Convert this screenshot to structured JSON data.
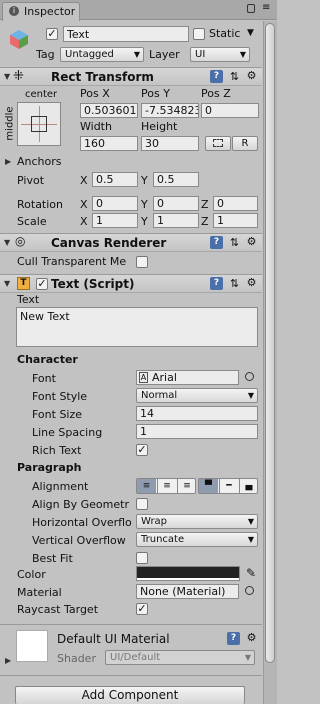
{
  "tab": {
    "label": "Inspector",
    "icon": "info-icon"
  },
  "header": {
    "object_name": "Text",
    "static_label": "Static",
    "tag_label": "Tag",
    "tag_value": "Untagged",
    "layer_label": "Layer",
    "layer_value": "UI"
  },
  "rect_transform": {
    "title": "Rect Transform",
    "anchor_h": "center",
    "anchor_v": "middle",
    "pos_x_label": "Pos X",
    "pos_y_label": "Pos Y",
    "pos_z_label": "Pos Z",
    "pos_x": "0.503601",
    "pos_y": "-7.534823",
    "pos_z": "0",
    "width_label": "Width",
    "height_label": "Height",
    "width": "160",
    "height": "30",
    "r_button": "R",
    "anchors_label": "Anchors",
    "pivot_label": "Pivot",
    "pivot_x": "0.5",
    "pivot_y": "0.5",
    "rotation_label": "Rotation",
    "rot_x": "0",
    "rot_y": "0",
    "rot_z": "0",
    "scale_label": "Scale",
    "scale_x": "1",
    "scale_y": "1",
    "scale_z": "1",
    "x": "X",
    "y": "Y",
    "z": "Z"
  },
  "canvas_renderer": {
    "title": "Canvas Renderer",
    "cull_label": "Cull Transparent Me"
  },
  "text_script": {
    "title": "Text (Script)",
    "text_label": "Text",
    "text_value": "New Text",
    "character_heading": "Character",
    "font_label": "Font",
    "font_value": "Arial",
    "font_style_label": "Font Style",
    "font_style_value": "Normal",
    "font_size_label": "Font Size",
    "font_size_value": "14",
    "line_spacing_label": "Line Spacing",
    "line_spacing_value": "1",
    "rich_text_label": "Rich Text",
    "paragraph_heading": "Paragraph",
    "alignment_label": "Alignment",
    "align_geometry_label": "Align By Geometr",
    "horizontal_overflow_label": "Horizontal Overflo",
    "horizontal_overflow_value": "Wrap",
    "vertical_overflow_label": "Vertical Overflow",
    "vertical_overflow_value": "Truncate",
    "best_fit_label": "Best Fit",
    "color_label": "Color",
    "color_value": "#222222",
    "material_label": "Material",
    "material_value": "None (Material)",
    "raycast_label": "Raycast Target"
  },
  "material_preview": {
    "name": "Default UI Material",
    "shader_label": "Shader",
    "shader_value": "UI/Default"
  },
  "add_component_label": "Add Component"
}
